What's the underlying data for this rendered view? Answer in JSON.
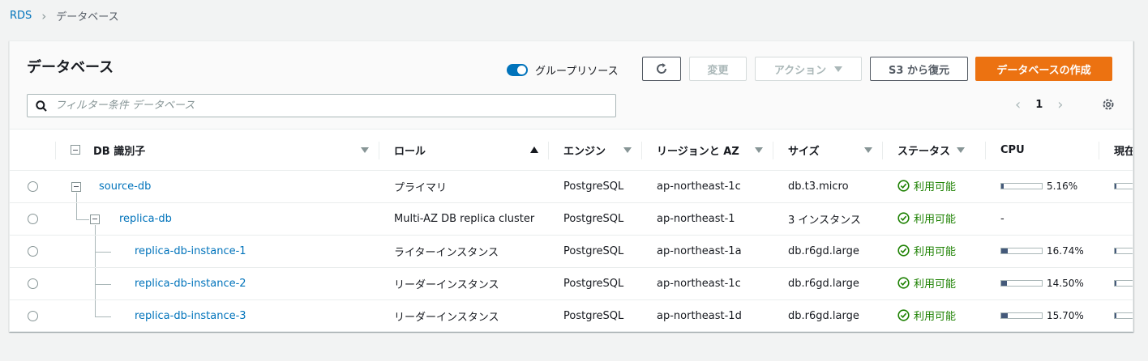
{
  "breadcrumb": {
    "root": "RDS",
    "current": "データベース"
  },
  "header": {
    "title": "データベース",
    "group_toggle_label": "グループリソース",
    "modify_label": "変更",
    "actions_label": "アクション",
    "restore_label": "S3 から復元",
    "create_label": "データベースの作成",
    "search_placeholder": "フィルター条件 データベース",
    "page_number": "1"
  },
  "table": {
    "columns": {
      "db_id": "DB 識別子",
      "role": "ロール",
      "engine": "エンジン",
      "region": "リージョンと AZ",
      "size": "サイズ",
      "status": "ステータス",
      "cpu": "CPU",
      "current": "現在"
    },
    "rows": [
      {
        "id": "source-db",
        "role": "プライマリ",
        "engine": "PostgreSQL",
        "region": "ap-northeast-1c",
        "size": "db.t3.micro",
        "status": "利用可能",
        "cpu_text": "5.16%",
        "cpu_value": 5.16
      },
      {
        "id": "replica-db",
        "role": "Multi-AZ DB replica cluster",
        "engine": "PostgreSQL",
        "region": "ap-northeast-1",
        "size": "3 インスタンス",
        "status": "利用可能",
        "cpu_text": "-",
        "cpu_value": null
      },
      {
        "id": "replica-db-instance-1",
        "role": "ライターインスタンス",
        "engine": "PostgreSQL",
        "region": "ap-northeast-1a",
        "size": "db.r6gd.large",
        "status": "利用可能",
        "cpu_text": "16.74%",
        "cpu_value": 16.74
      },
      {
        "id": "replica-db-instance-2",
        "role": "リーダーインスタンス",
        "engine": "PostgreSQL",
        "region": "ap-northeast-1c",
        "size": "db.r6gd.large",
        "status": "利用可能",
        "cpu_text": "14.50%",
        "cpu_value": 14.5
      },
      {
        "id": "replica-db-instance-3",
        "role": "リーダーインスタンス",
        "engine": "PostgreSQL",
        "region": "ap-northeast-1d",
        "size": "db.r6gd.large",
        "status": "利用可能",
        "cpu_text": "15.70%",
        "cpu_value": 15.7
      }
    ]
  },
  "colors": {
    "link": "#0073bb",
    "primary": "#ec7211",
    "available": "#1d8102"
  }
}
